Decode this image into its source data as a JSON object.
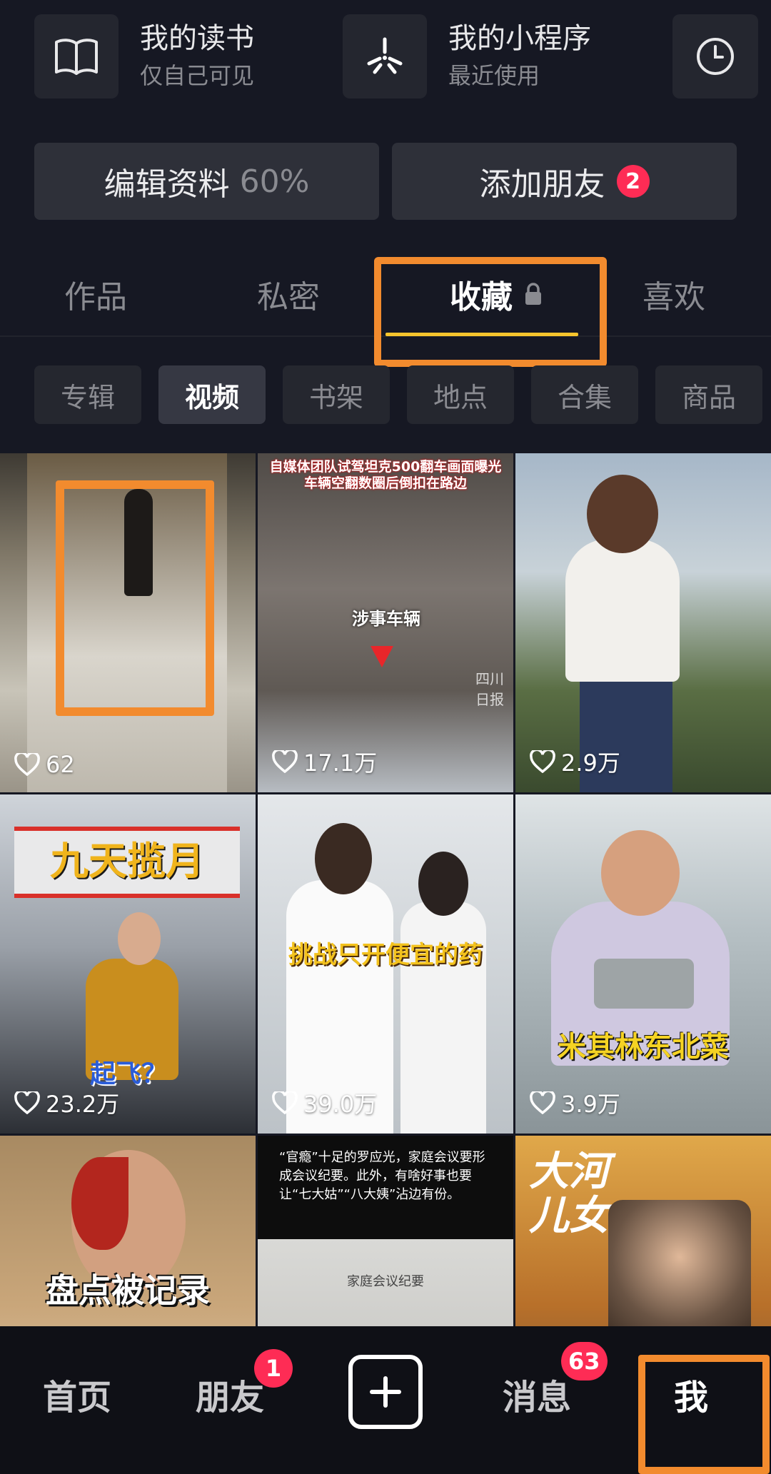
{
  "top_cards": {
    "reading": {
      "title": "我的读书",
      "subtitle": "仅自己可见",
      "icon": "book-icon"
    },
    "miniapp": {
      "title": "我的小程序",
      "subtitle": "最近使用",
      "icon": "asterisk-icon"
    },
    "recent_icon": "clock-icon"
  },
  "actions": {
    "edit_profile_label": "编辑资料",
    "edit_profile_pct": "60%",
    "add_friends_label": "添加朋友",
    "add_friends_badge": "2"
  },
  "tabs": [
    {
      "label": "作品"
    },
    {
      "label": "私密"
    },
    {
      "label": "收藏",
      "active": true,
      "locked": true
    },
    {
      "label": "喜欢"
    }
  ],
  "filters": [
    {
      "label": "专辑"
    },
    {
      "label": "视频",
      "active": true
    },
    {
      "label": "书架"
    },
    {
      "label": "地点"
    },
    {
      "label": "合集"
    },
    {
      "label": "商品"
    }
  ],
  "videos": [
    {
      "likes": "62"
    },
    {
      "likes": "17.1万",
      "caption": "自媒体团队试驾坦克500翻车画面曝光\n车辆空翻数圈后倒扣在路边",
      "tag": "涉事车辆",
      "watermark": "四川日报"
    },
    {
      "likes": "2.9万"
    },
    {
      "likes": "23.2万",
      "caption": "九天揽月",
      "tag": "起飞？"
    },
    {
      "likes": "39.0万",
      "caption": "挑战只开便宜的药"
    },
    {
      "likes": "3.9万",
      "caption": "米其林东北菜"
    },
    {
      "likes": "",
      "caption": "盘点被记录"
    },
    {
      "likes": "",
      "caption": "“官瘾”十足的罗应光，家庭会议要形成会议纪要。此外，有啥好事也要让“七大姑”“八大姨”沾边有份。",
      "doc_title": "家庭会议纪要"
    },
    {
      "likes": "",
      "caption": "大河儿女"
    }
  ],
  "bottom_nav": {
    "home": "首页",
    "friends": "朋友",
    "friends_badge": "1",
    "messages": "消息",
    "messages_badge": "63",
    "me": "我"
  },
  "colors": {
    "accent_yellow": "#f6c42d",
    "badge_red": "#fe2c55",
    "highlight_orange": "#f28b2e",
    "bg": "#161823"
  }
}
